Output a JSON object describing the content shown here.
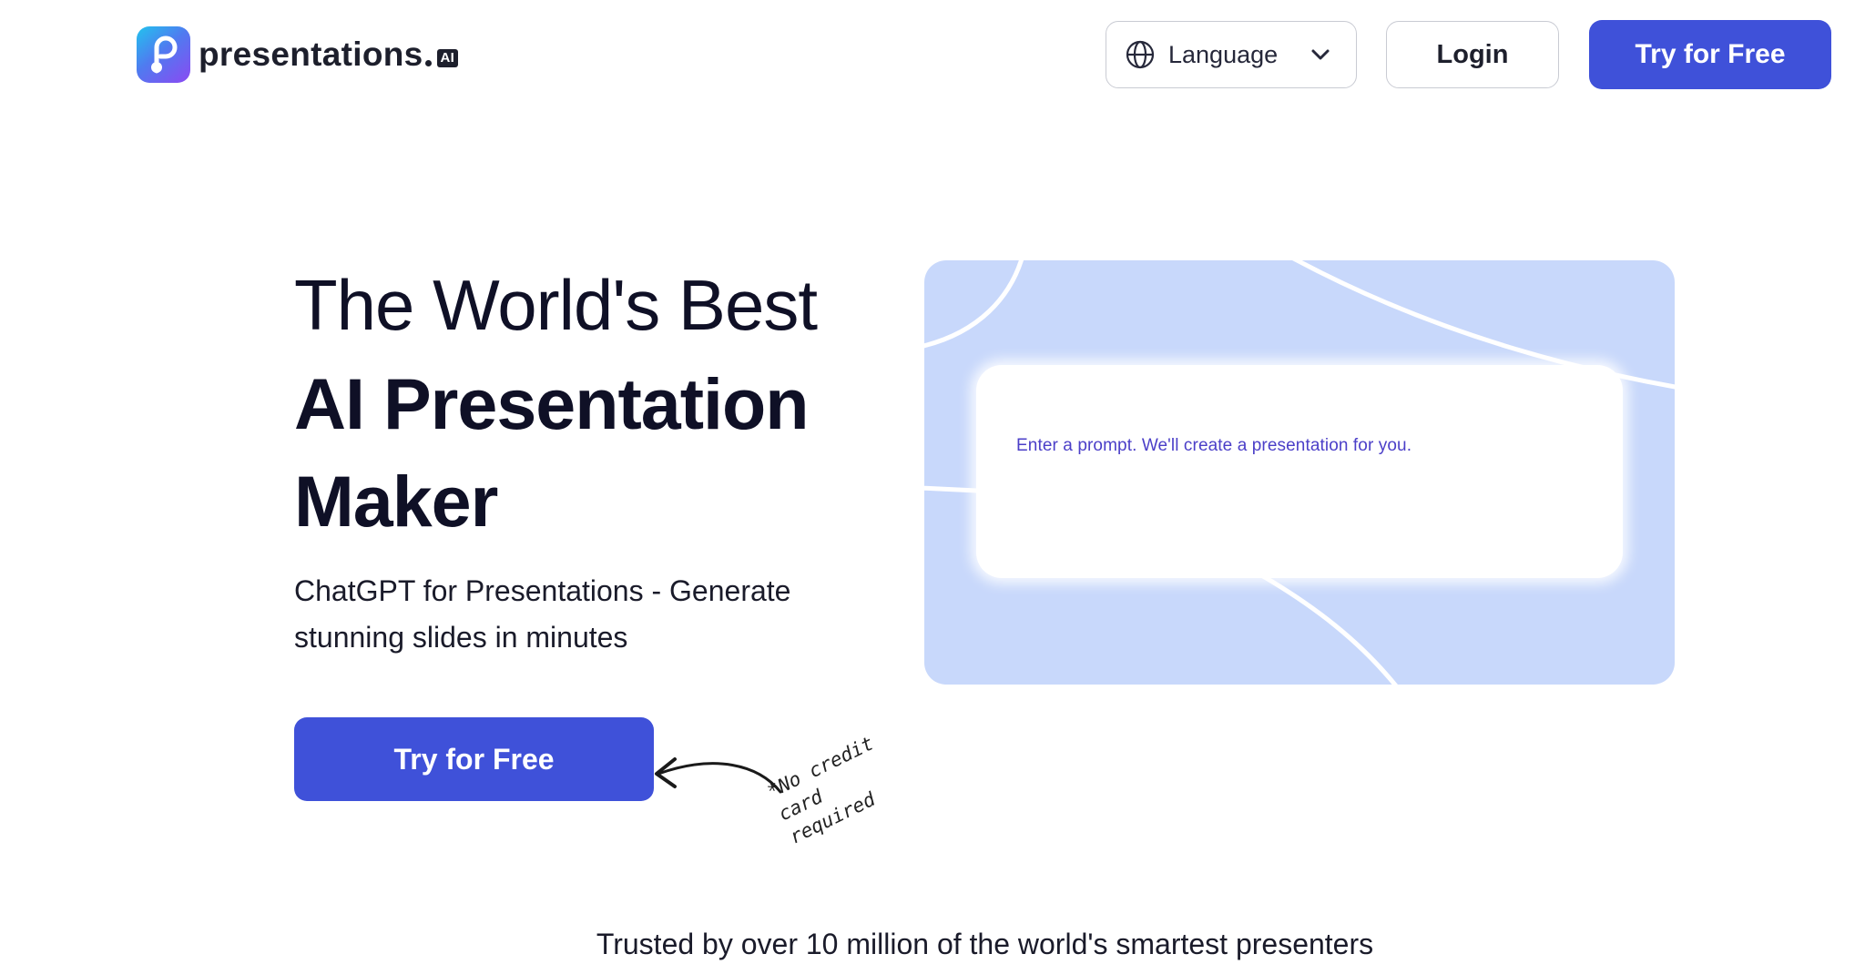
{
  "header": {
    "brand_name": "presentations",
    "brand_suffix": "AI",
    "language_label": "Language",
    "login_label": "Login",
    "try_free_label": "Try for Free"
  },
  "hero": {
    "line1": "The World's Best",
    "line2": "AI Presentation",
    "line3": "Maker",
    "subtitle": "ChatGPT for Presentations - Generate stunning slides in minutes",
    "cta_label": "Try for Free",
    "note": "*No credit card required"
  },
  "preview": {
    "prompt_placeholder": "Enter a prompt. We'll create a presentation for you."
  },
  "trusted_text": "Trusted by over 10 million of the world's smartest presenters",
  "colors": {
    "primary": "#3f51d9",
    "preview_bg": "#c8d8fb",
    "prompt_text": "#4b3fc8",
    "heading": "#0f1026"
  }
}
